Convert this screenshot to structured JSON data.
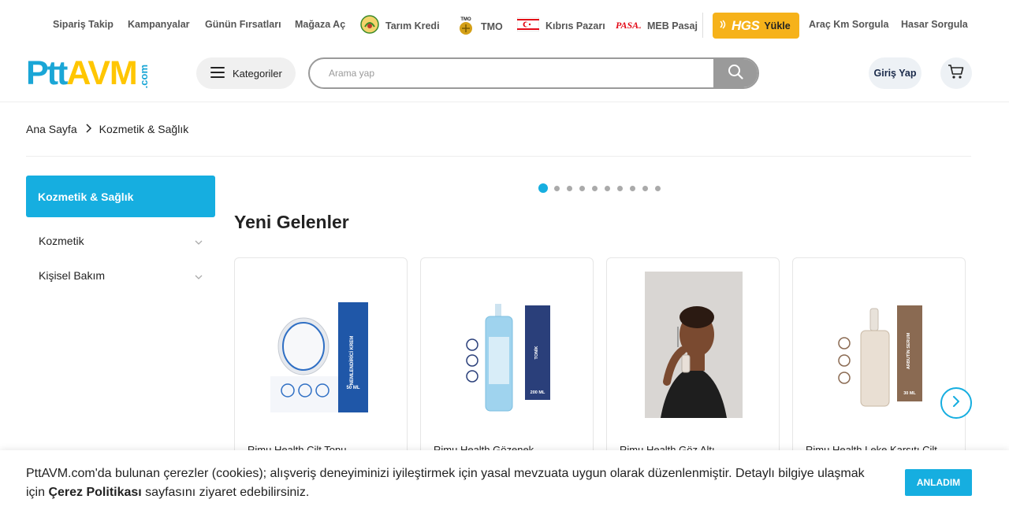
{
  "topbar": {
    "links": [
      {
        "label": "Sipariş Takip"
      },
      {
        "label": "Kampanyalar"
      },
      {
        "label": "Günün Fırsatları"
      },
      {
        "label": "Mağaza Aç"
      },
      {
        "label": "Tarım Kredi",
        "icon": "tarim-kredi-logo-icon"
      },
      {
        "label": "TMO",
        "icon": "tmo-logo-icon",
        "icon_text": "TMO"
      },
      {
        "label": "Kıbrıs Pazarı",
        "icon": "kktc-flag-icon"
      },
      {
        "label": "MEB Pasaj",
        "icon": "pasaj-logo-icon",
        "icon_text": "PASAJ"
      }
    ],
    "hgs": {
      "logo": "HGS",
      "label": "Yükle"
    },
    "right_links": [
      {
        "label": "Araç Km Sorgula"
      },
      {
        "label": "Hasar Sorgula"
      }
    ]
  },
  "header": {
    "logo": {
      "ptt": "Ptt",
      "avm": "AVM",
      "com": ".com"
    },
    "categories_label": "Kategoriler",
    "search": {
      "placeholder": "Arama yap"
    },
    "login_label": "Giriş Yap"
  },
  "breadcrumb": {
    "home": "Ana Sayfa",
    "current": "Kozmetik & Sağlık"
  },
  "sidebar": {
    "active": "Kozmetik & Sağlık",
    "items": [
      {
        "label": "Kozmetik"
      },
      {
        "label": "Kişisel Bakım"
      }
    ]
  },
  "carousel": {
    "total_dots": 10,
    "active_index": 0
  },
  "section": {
    "title": "Yeni Gelenler"
  },
  "products": [
    {
      "name": "Rimu Health Cilt Tonu",
      "label": "NEMLENDİRİCİ KREM",
      "size": "50 ML"
    },
    {
      "name": "Rimu Health Gözenek",
      "label": "TONİK",
      "size": "200 ML"
    },
    {
      "name": "Rimu Health Göz Altı"
    },
    {
      "name": "Rimu Health Leke Karşıtı Cilt",
      "label": "ARBUTİN SERUM",
      "size": "30 ML"
    }
  ],
  "colors": {
    "accent": "#16aee0",
    "ptt_blue": "#1aa6d6",
    "avm_yellow": "#ffc600",
    "hgs_yellow": "#f6b21a"
  },
  "cookie": {
    "text_before": "PttAVM.com'da bulunan çerezler (cookies); alışveriş deneyiminizi iyileştirmek için yasal mevzuata uygun olarak düzenlenmiştir. Detaylı bilgiye ulaşmak için ",
    "link": "Çerez Politikası",
    "text_after": " sayfasını ziyaret edebilirsiniz.",
    "button": "ANLADIM"
  }
}
